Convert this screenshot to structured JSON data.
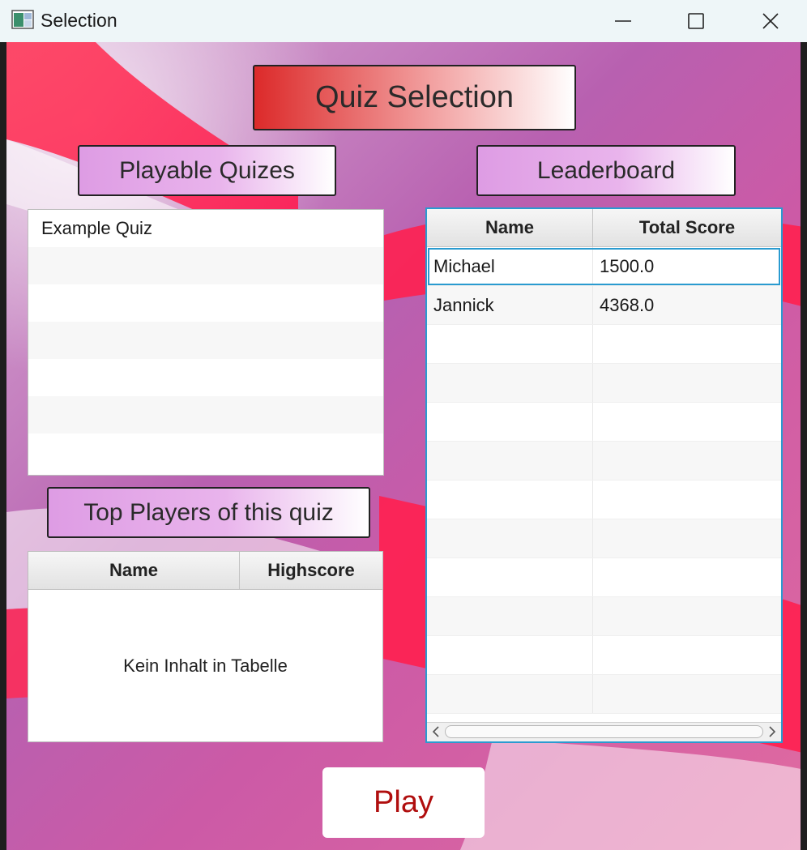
{
  "window": {
    "title": "Selection",
    "icon": "app-window-icon",
    "controls": {
      "minimize": "minimize-icon",
      "maximize": "maximize-icon",
      "close": "close-icon"
    }
  },
  "header": {
    "title": "Quiz Selection"
  },
  "playable": {
    "title": "Playable Quizes",
    "items": [
      "Example Quiz"
    ]
  },
  "top_players": {
    "title": "Top Players of this quiz",
    "columns": [
      "Name",
      "Highscore"
    ],
    "empty_text": "Kein Inhalt in Tabelle"
  },
  "leaderboard": {
    "title": "Leaderboard",
    "columns": [
      "Name",
      "Total Score"
    ],
    "rows": [
      {
        "name": "Michael",
        "score": "1500.0"
      },
      {
        "name": "Jannick",
        "score": "4368.0"
      }
    ]
  },
  "actions": {
    "play_label": "Play"
  },
  "colors": {
    "accent_red": "#dc2a2a",
    "label_pink": "#de9ce4",
    "selection_blue": "#2a9bd0",
    "play_text": "#b00e0e"
  }
}
